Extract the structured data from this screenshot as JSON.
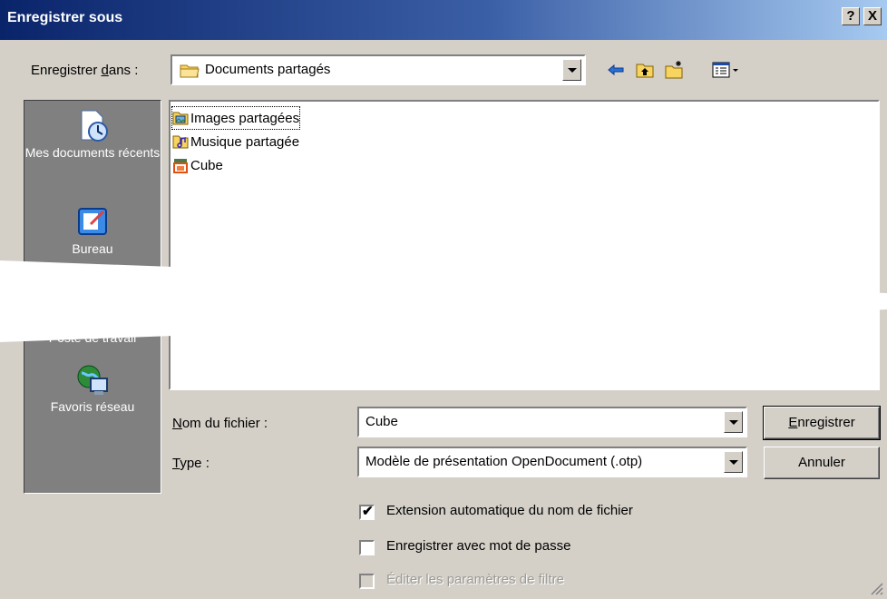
{
  "window": {
    "title": "Enregistrer sous",
    "help_btn": "?",
    "close_btn": "X"
  },
  "save_in": {
    "label_pre": "Enregistrer ",
    "label_key": "d",
    "label_post": "ans :",
    "value": "Documents partagés"
  },
  "toolbar": {
    "back": "back-arrow-icon",
    "up": "up-folder-icon",
    "new_folder": "new-folder-icon",
    "view": "view-menu-icon"
  },
  "places": [
    {
      "label": "Mes documents récents",
      "icon": "recent-documents-icon"
    },
    {
      "label": "Bureau",
      "icon": "desktop-icon"
    },
    {
      "label": "Poste de travail",
      "icon": "my-computer-icon"
    },
    {
      "label": "Favoris réseau",
      "icon": "network-places-icon"
    }
  ],
  "files": [
    {
      "name": "Images partagées",
      "icon": "shared-pictures-folder-icon"
    },
    {
      "name": "Musique partagée",
      "icon": "shared-music-folder-icon"
    },
    {
      "name": "Cube",
      "icon": "cube-file-icon"
    }
  ],
  "filename": {
    "label_key": "N",
    "label_rest": "om du fichier :",
    "value": "Cube"
  },
  "type": {
    "label_key": "T",
    "label_rest": "ype :",
    "value": "Modèle de présentation OpenDocument (.otp)"
  },
  "buttons": {
    "save_key": "E",
    "save_rest": "nregistrer",
    "cancel": "Annuler"
  },
  "checkboxes": [
    {
      "label": "Extension automatique du nom de fichier",
      "checked": true,
      "enabled": true
    },
    {
      "label": "Enregistrer avec mot de passe",
      "checked": false,
      "enabled": true
    },
    {
      "label": "Éditer les paramètres de filtre",
      "checked": false,
      "enabled": false
    }
  ],
  "colors": {
    "titlebar_start": "#0a246a",
    "titlebar_end": "#a6caf0",
    "dialog_bg": "#d4d0c8",
    "places_bg": "#808080"
  }
}
